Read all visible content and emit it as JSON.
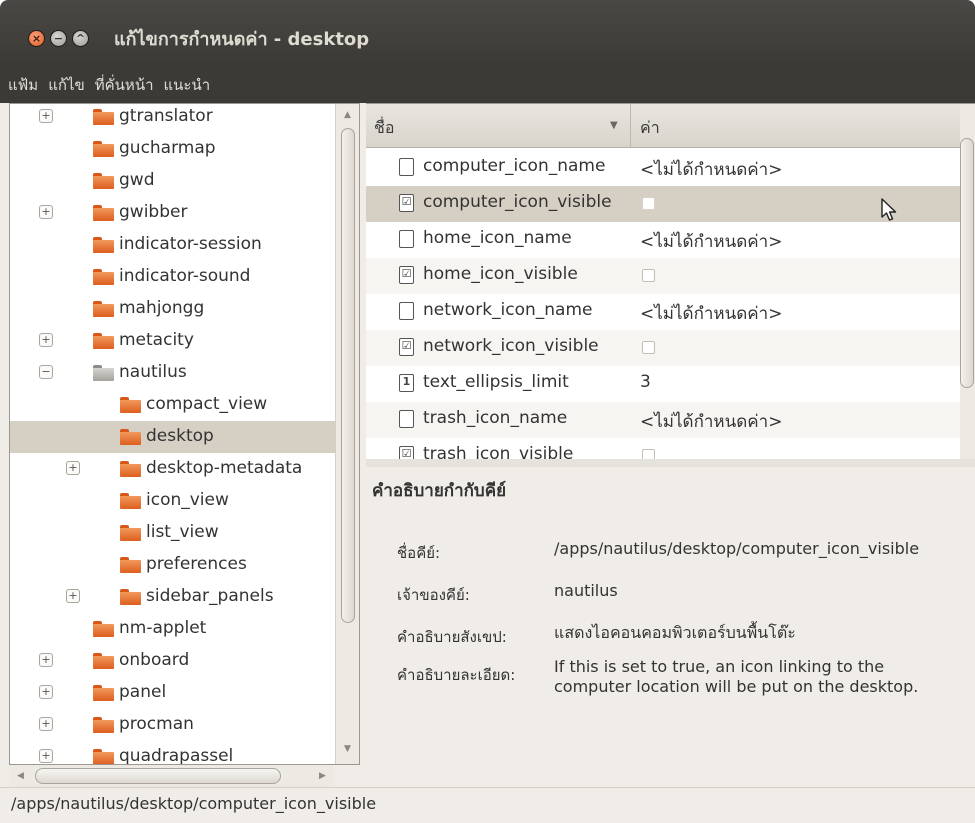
{
  "window": {
    "title": "แก้ไขการกำหนดค่า - desktop",
    "buttons": {
      "close": "×",
      "minimize": "−",
      "maximize": "^"
    }
  },
  "menu": [
    "แฟ้ม",
    "แก้ไข",
    "ที่คั่นหน้า",
    "แนะนำ"
  ],
  "tree": [
    {
      "label": "gtranslator",
      "expander": "+",
      "depth": 0,
      "folder": "orange"
    },
    {
      "label": "gucharmap",
      "expander": "",
      "depth": 0,
      "folder": "orange"
    },
    {
      "label": "gwd",
      "expander": "",
      "depth": 0,
      "folder": "orange"
    },
    {
      "label": "gwibber",
      "expander": "+",
      "depth": 0,
      "folder": "orange"
    },
    {
      "label": "indicator-session",
      "expander": "",
      "depth": 0,
      "folder": "orange"
    },
    {
      "label": "indicator-sound",
      "expander": "",
      "depth": 0,
      "folder": "orange"
    },
    {
      "label": "mahjongg",
      "expander": "",
      "depth": 0,
      "folder": "orange"
    },
    {
      "label": "metacity",
      "expander": "+",
      "depth": 0,
      "folder": "orange"
    },
    {
      "label": "nautilus",
      "expander": "−",
      "depth": 0,
      "folder": "grey"
    },
    {
      "label": "compact_view",
      "expander": "",
      "depth": 1,
      "folder": "orange"
    },
    {
      "label": "desktop",
      "expander": "",
      "depth": 1,
      "folder": "orange",
      "selected": true
    },
    {
      "label": "desktop-metadata",
      "expander": "+",
      "depth": 1,
      "folder": "orange"
    },
    {
      "label": "icon_view",
      "expander": "",
      "depth": 1,
      "folder": "orange"
    },
    {
      "label": "list_view",
      "expander": "",
      "depth": 1,
      "folder": "orange"
    },
    {
      "label": "preferences",
      "expander": "",
      "depth": 1,
      "folder": "orange"
    },
    {
      "label": "sidebar_panels",
      "expander": "+",
      "depth": 1,
      "folder": "orange"
    },
    {
      "label": "nm-applet",
      "expander": "",
      "depth": 0,
      "folder": "orange"
    },
    {
      "label": "onboard",
      "expander": "+",
      "depth": 0,
      "folder": "orange"
    },
    {
      "label": "panel",
      "expander": "+",
      "depth": 0,
      "folder": "orange"
    },
    {
      "label": "procman",
      "expander": "+",
      "depth": 0,
      "folder": "orange"
    },
    {
      "label": "quadrapassel",
      "expander": "+",
      "depth": 0,
      "folder": "orange"
    }
  ],
  "list": {
    "headers": {
      "name": "ชื่อ",
      "value": "ค่า"
    },
    "rows": [
      {
        "name": "computer_icon_name",
        "type": "string",
        "icon_glyph": "",
        "value": "<ไม่ได้กำหนดค่า>"
      },
      {
        "name": "computer_icon_visible",
        "type": "bool",
        "icon_glyph": "☑",
        "value": "",
        "selected": true
      },
      {
        "name": "home_icon_name",
        "type": "string",
        "icon_glyph": "",
        "value": "<ไม่ได้กำหนดค่า>"
      },
      {
        "name": "home_icon_visible",
        "type": "bool",
        "icon_glyph": "☑",
        "value": ""
      },
      {
        "name": "network_icon_name",
        "type": "string",
        "icon_glyph": "",
        "value": "<ไม่ได้กำหนดค่า>"
      },
      {
        "name": "network_icon_visible",
        "type": "bool",
        "icon_glyph": "☑",
        "value": ""
      },
      {
        "name": "text_ellipsis_limit",
        "type": "int",
        "icon_glyph": "1",
        "value": "3"
      },
      {
        "name": "trash_icon_name",
        "type": "string",
        "icon_glyph": "",
        "value": "<ไม่ได้กำหนดค่า>"
      },
      {
        "name": "trash_icon_visible",
        "type": "bool",
        "icon_glyph": "☑",
        "value": ""
      }
    ]
  },
  "details": {
    "title": "คำอธิบายกำกับคีย์",
    "key_name_label": "ชื่อคีย์:",
    "key_name": "/apps/nautilus/desktop/computer_icon_visible",
    "owner_label": "เจ้าของคีย์:",
    "owner": "nautilus",
    "short_desc_label": "คำอธิบายสังเขป:",
    "short_desc": "แสดงไอคอนคอมพิวเตอร์บนพื้นโต๊ะ",
    "long_desc_label": "คำอธิบายละเอียด:",
    "long_desc_line1": "If this is set to true, an icon linking to the",
    "long_desc_line2": "computer location will be put on the desktop."
  },
  "status": {
    "path": "/apps/nautilus/desktop/computer_icon_visible"
  },
  "colors": {
    "titlebar": "#3b3a36",
    "selection": "#d6cfc4",
    "folder": "#dd5e20",
    "close_button": "#e25b22"
  }
}
